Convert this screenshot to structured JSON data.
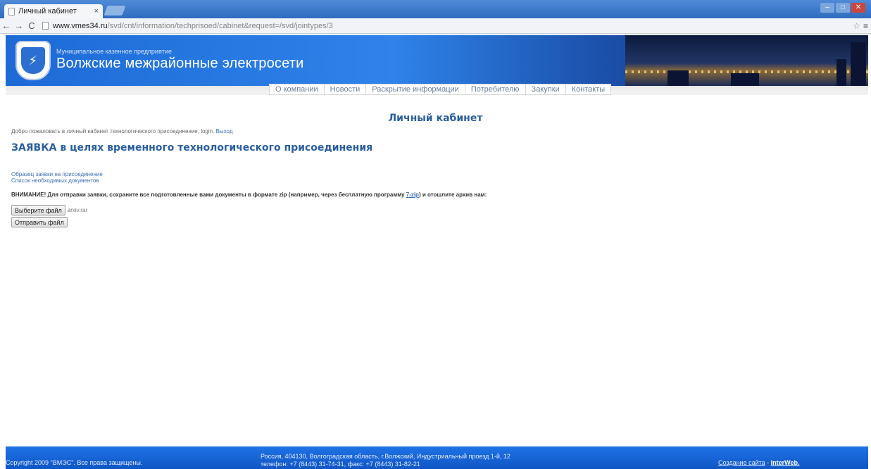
{
  "browser": {
    "tab_title": "Личный кабинет",
    "tab_close": "×",
    "url_host": "www.vmes34.ru",
    "url_path": "/svd/cnt/information/techprisoed/cabinet&request=/svd/jointypes/3"
  },
  "header": {
    "org_subtitle": "Муниципальное казенное предприятие",
    "org_name": "Волжские межрайонные электросети"
  },
  "nav": {
    "items": [
      {
        "label": "О компании"
      },
      {
        "label": "Новости"
      },
      {
        "label": "Раскрытие информации"
      },
      {
        "label": "Потребителю"
      },
      {
        "label": "Закупки"
      },
      {
        "label": "Контакты"
      }
    ]
  },
  "main": {
    "page_title": "Личный кабинет",
    "welcome_text": "Добро пожаловать в личный кабинет технологического присоединение, login.",
    "logout_label": "Выход",
    "request_title": "ЗАЯВКА в целях временного технологического присоединения",
    "doc_links": [
      {
        "label": "Образец заявки на присоединение"
      },
      {
        "label": "Список необходимых документов"
      }
    ],
    "notice_before": "ВНИМАНИЕ! Для отправки заявки, сохраните все подготовленные вами документы в формате zip (например, через бесплатную программу ",
    "notice_link": "7-zip",
    "notice_after": ") и отошлите архив нам:",
    "choose_file_label": "Выберите файл",
    "chosen_filename": "arxiv.rar",
    "send_file_label": "Отправить файл"
  },
  "footer": {
    "copyright": "Copyright 2009 \"ВМЭС\". Все права защищены.",
    "address_line1": "Россия, 404130, Волгоградская область, г.Волжский, Индустриальный проезд 1-й, 12",
    "address_line2": "телефон: +7 (8443) 31-74-31, факс: +7 (8443) 31-82-21",
    "made_by_label": "Создание сайта",
    "separator": " - ",
    "made_by_company": "InterWeb."
  }
}
